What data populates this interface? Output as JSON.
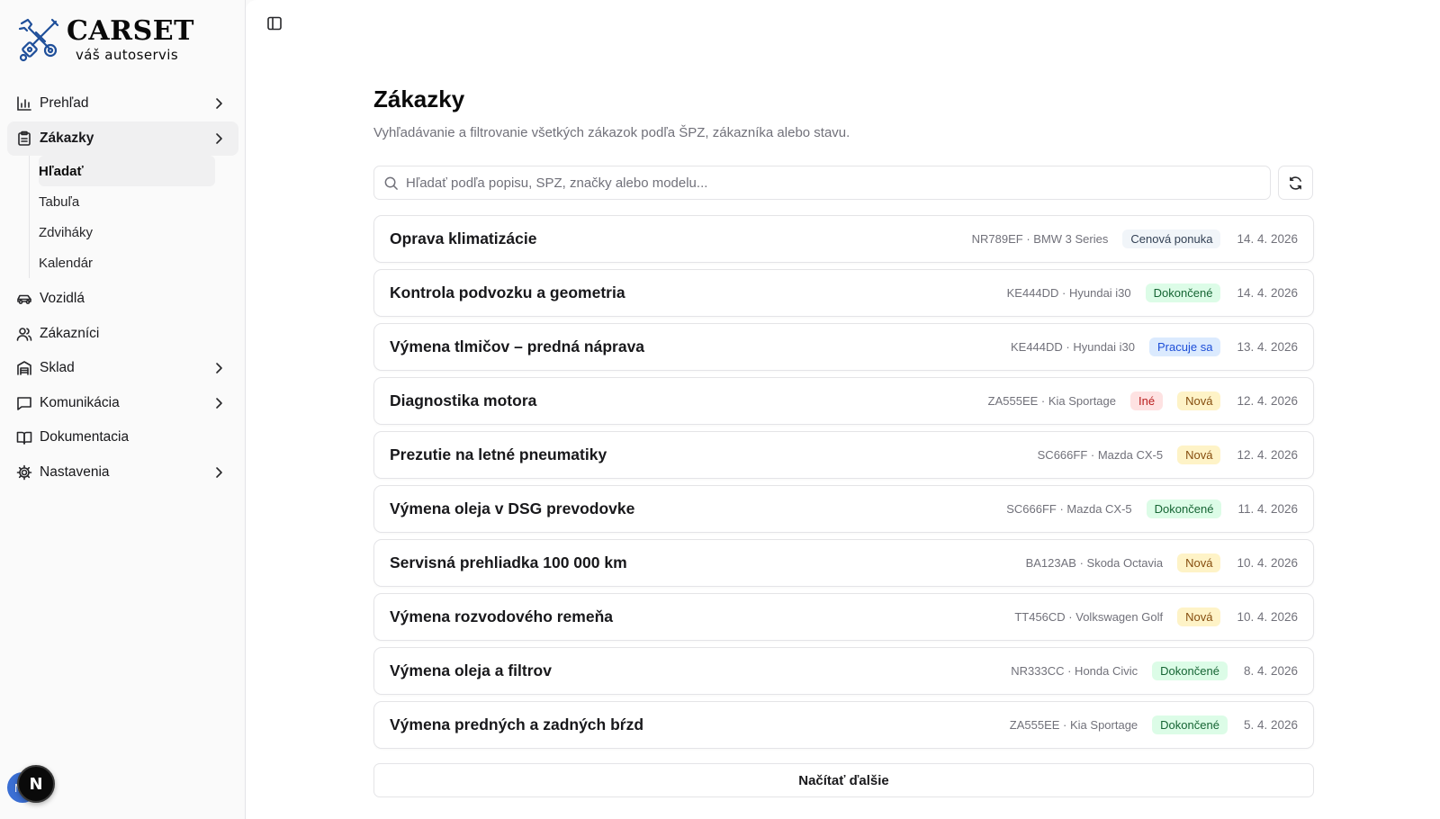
{
  "brand": {
    "title": "CARSET",
    "subtitle": "váš autoservis"
  },
  "sidebar": {
    "items": [
      {
        "label": "Prehľad",
        "icon": "bar-chart-icon",
        "chevron": true
      },
      {
        "label": "Zákazky",
        "icon": "clipboard-icon",
        "chevron": true,
        "active": true
      },
      {
        "label": "Vozidlá",
        "icon": "car-icon",
        "chevron": false
      },
      {
        "label": "Zákazníci",
        "icon": "users-icon",
        "chevron": false
      },
      {
        "label": "Sklad",
        "icon": "warehouse-icon",
        "chevron": true
      },
      {
        "label": "Komunikácia",
        "icon": "message-icon",
        "chevron": true
      },
      {
        "label": "Dokumentacia",
        "icon": "book-icon",
        "chevron": false
      },
      {
        "label": "Nastavenia",
        "icon": "gear-icon",
        "chevron": true
      }
    ],
    "subitems": [
      {
        "label": "Hľadať",
        "active": true
      },
      {
        "label": "Tabuľa"
      },
      {
        "label": "Zdviháky"
      },
      {
        "label": "Kalendár"
      }
    ],
    "avatar_initial": "M",
    "next_badge": "N"
  },
  "main": {
    "title": "Zákazky",
    "subtitle": "Vyhľadávanie a filtrovanie všetkých zákazok podľa ŠPZ, zákazníka alebo stavu.",
    "search_placeholder": "Hľadať podľa popisu, SPZ, značky alebo modelu...",
    "load_more": "Načítať ďalšie",
    "orders": [
      {
        "title": "Oprava klimatizácie",
        "meta": "NR789EF · BMW 3 Series",
        "badges": [
          {
            "label": "Cenová ponuka",
            "kind": "quote"
          }
        ],
        "date": "14. 4. 2026"
      },
      {
        "title": "Kontrola podvozku a geometria",
        "meta": "KE444DD · Hyundai i30",
        "badges": [
          {
            "label": "Dokončené",
            "kind": "done"
          }
        ],
        "date": "14. 4. 2026"
      },
      {
        "title": "Výmena tlmičov – predná náprava",
        "meta": "KE444DD · Hyundai i30",
        "badges": [
          {
            "label": "Pracuje sa",
            "kind": "work"
          }
        ],
        "date": "13. 4. 2026"
      },
      {
        "title": "Diagnostika motora",
        "meta": "ZA555EE · Kia Sportage",
        "badges": [
          {
            "label": "Iné",
            "kind": "other"
          },
          {
            "label": "Nová",
            "kind": "new"
          }
        ],
        "date": "12. 4. 2026"
      },
      {
        "title": "Prezutie na letné pneumatiky",
        "meta": "SC666FF · Mazda CX-5",
        "badges": [
          {
            "label": "Nová",
            "kind": "new"
          }
        ],
        "date": "12. 4. 2026"
      },
      {
        "title": "Výmena oleja v DSG prevodovke",
        "meta": "SC666FF · Mazda CX-5",
        "badges": [
          {
            "label": "Dokončené",
            "kind": "done"
          }
        ],
        "date": "11. 4. 2026"
      },
      {
        "title": "Servisná prehliadka 100 000 km",
        "meta": "BA123AB · Skoda Octavia",
        "badges": [
          {
            "label": "Nová",
            "kind": "new"
          }
        ],
        "date": "10. 4. 2026"
      },
      {
        "title": "Výmena rozvodového remeňa",
        "meta": "TT456CD · Volkswagen Golf",
        "badges": [
          {
            "label": "Nová",
            "kind": "new"
          }
        ],
        "date": "10. 4. 2026"
      },
      {
        "title": "Výmena oleja a filtrov",
        "meta": "NR333CC · Honda Civic",
        "badges": [
          {
            "label": "Dokončené",
            "kind": "done"
          }
        ],
        "date": "8. 4. 2026"
      },
      {
        "title": "Výmena predných a zadných bŕzd",
        "meta": "ZA555EE · Kia Sportage",
        "badges": [
          {
            "label": "Dokončené",
            "kind": "done"
          }
        ],
        "date": "5. 4. 2026"
      }
    ]
  }
}
